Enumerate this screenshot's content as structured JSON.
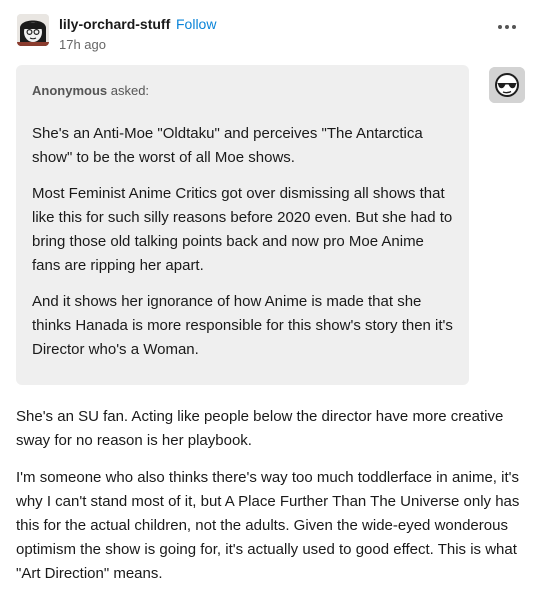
{
  "post": {
    "username": "lily-orchard-stuff",
    "follow_label": "Follow",
    "time": "17h ago"
  },
  "ask": {
    "asker_name": "Anonymous",
    "asker_suffix": " asked:",
    "paragraphs": [
      "She's an Anti-Moe \"Oldtaku\" and perceives \"The Antarctica show\" to be the worst of all Moe shows.",
      "Most Feminist Anime Critics got over dismissing all shows that like this for such silly reasons before 2020 even.  But she had to bring those old talking points back and now pro Moe Anime fans are ripping her apart.",
      "And it shows her ignorance of how Anime is made that she thinks Hanada is more responsible for this show's story then it's Director who's a Woman."
    ]
  },
  "answer": {
    "paragraphs": [
      "She's an SU fan. Acting like people below the director have more creative sway for no reason is her playbook.",
      "I'm someone who also thinks there's way too much toddlerface in anime, it's why I can't stand most of it, but A Place Further Than The Universe only has this for the actual children, not the adults. Given the wide-eyed wonderous optimism the show is going for, it's actually used to good effect. This is what \"Art Direction\" means."
    ]
  },
  "icons": {
    "avatar": "avatar-cartoon-icon",
    "more": "more-options-icon",
    "anon_avatar": "anonymous-sunglasses-icon"
  }
}
